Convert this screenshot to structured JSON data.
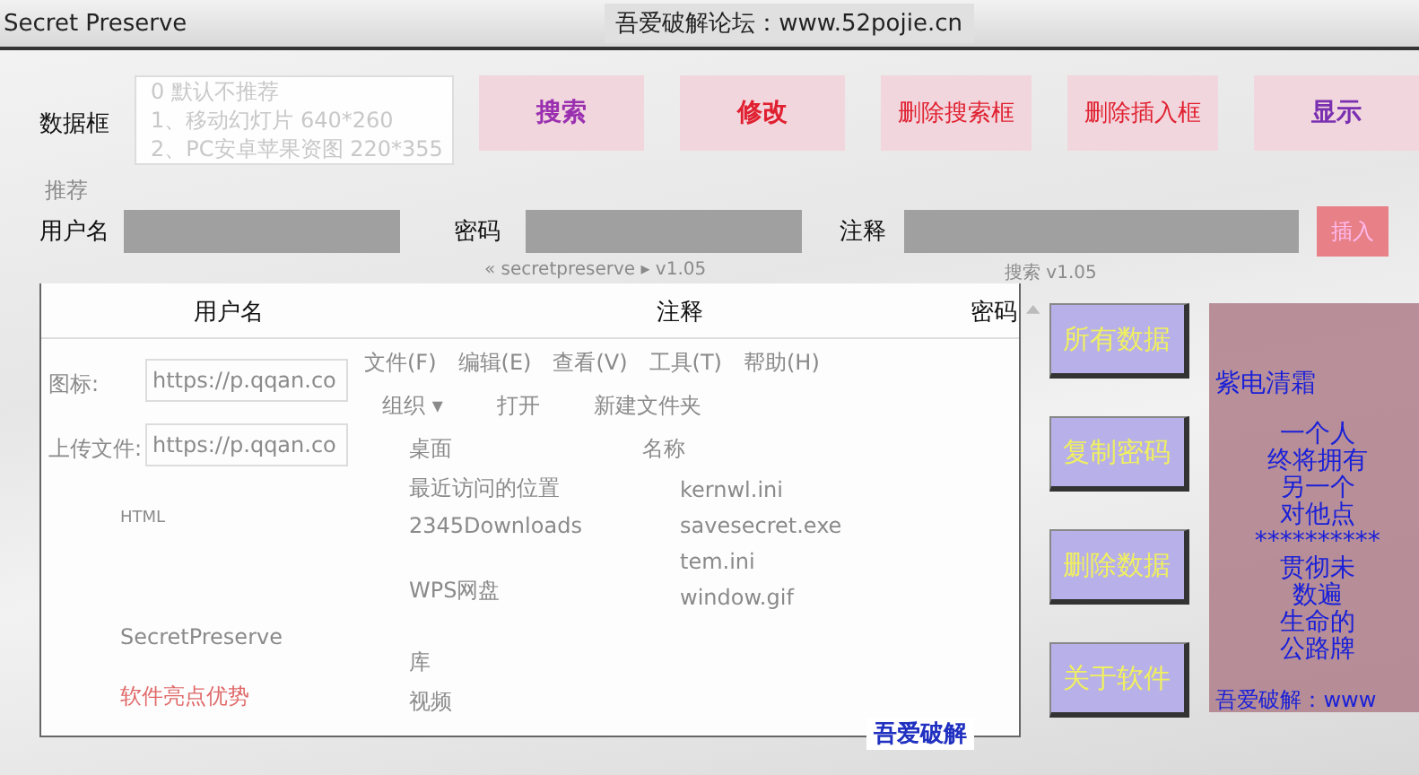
{
  "window": {
    "title": "Secret Preserve",
    "caption": "吾爱破解论坛：www.52pojie.cn"
  },
  "data_box": {
    "label": "数据框",
    "items": [
      "0 默认不推荐",
      "1、移动幻灯片 640*260",
      "2、PC安卓苹果资图 220*355"
    ]
  },
  "toolbar_buttons": [
    {
      "label": "搜索",
      "color": "#9a30b0"
    },
    {
      "label": "修改",
      "color": "#e02030"
    },
    {
      "label": "删除搜索框",
      "color": "#e02030"
    },
    {
      "label": "删除插入框",
      "color": "#e02030"
    },
    {
      "label": "显示",
      "color": "#7a30b0"
    }
  ],
  "hint": "推荐",
  "fields": [
    {
      "label": "用户名"
    },
    {
      "label": "密码"
    },
    {
      "label": "注释"
    }
  ],
  "insert_button": "插入",
  "table": {
    "columns": [
      "用户名",
      "注释",
      "密码"
    ],
    "caption": "吾爱破解"
  },
  "side_buttons": [
    "所有数据",
    "复制密码",
    "删除数据",
    "关于软件"
  ],
  "poem": {
    "title": "紫电清霜",
    "lines": [
      "一个人",
      "终将拥有",
      "另一个",
      "对他点",
      "**********",
      "贯彻未",
      "数遍",
      "生命的",
      "公路牌"
    ],
    "footer": "吾爱破解：www"
  },
  "background_windows": {
    "browser": {
      "fields": [
        {
          "label": "图标:",
          "value": "https://p.qqan.co"
        },
        {
          "label": "上传文件:",
          "value": "https://p.qqan.co"
        }
      ],
      "editor_tag": "HTML",
      "doc_title": "SecretPreserve",
      "highlight": "软件亮点优势"
    },
    "explorer": {
      "path": "« secretpreserve ▸ v1.05",
      "search_placeholder": "搜索 v1.05",
      "menu": [
        "文件(F)",
        "编辑(E)",
        "查看(V)",
        "工具(T)",
        "帮助(H)"
      ],
      "toolbar": [
        "组织 ▾",
        "打开",
        "新建文件夹"
      ],
      "nav": [
        "桌面",
        "最近访问的位置",
        "2345Downloads",
        "WPS网盘",
        "库",
        "视频"
      ],
      "name_column": "名称",
      "files": [
        "kernwl.ini",
        "savesecret.exe",
        "tem.ini",
        "window.gif"
      ]
    }
  }
}
